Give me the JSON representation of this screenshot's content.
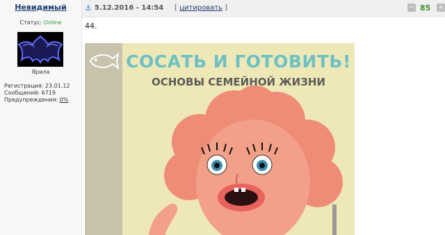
{
  "user": {
    "name": "Невидимый",
    "status_label": "Статус:",
    "status_value": "Online",
    "rank": "Ярила",
    "registration": "Регистрация: 23.01.12",
    "messages": "Сообщений: 6719",
    "warnings_label": "Предупреждения:",
    "warnings_value": "0%"
  },
  "post": {
    "date": "5.12.2016 - 14:54",
    "quote_left": "[",
    "quote_label": "цитировать",
    "quote_right": "]",
    "rating": "85",
    "text": "44."
  },
  "image": {
    "title": "СОСАТЬ И ГОТОВИТЬ!",
    "subtitle": "ОСНОВЫ СЕМЕЙНОЙ ЖИЗНИ"
  },
  "colors": {
    "online": "#2e9d2e",
    "rating": "#3d8f2d",
    "title": "#6dc0c3",
    "hair": "#ef8c78",
    "background_art": "#eee8b6"
  }
}
